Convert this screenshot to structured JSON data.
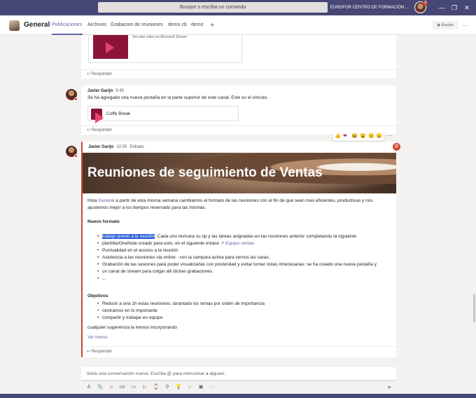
{
  "titlebar": {
    "search_placeholder": "Busque o escriba un comando",
    "org": "EUROFOR CENTRO DE FORMACIÓN ...",
    "badge": "3",
    "win": {
      "minimize": "—",
      "restore": "❐",
      "close": "✕"
    }
  },
  "header": {
    "channel": "General",
    "tabs": [
      "Publicaciones",
      "Archivos",
      "Grabacion de reuniones",
      "demo cb",
      "demo"
    ],
    "add": "+",
    "team_btn": "◉ Equipo",
    "more": "···"
  },
  "messages": {
    "top": {
      "caption": "Ver este vídeo en Microsoft Stream",
      "reply": "↩ Responder"
    },
    "m1": {
      "author": "Javier Garijo",
      "time": "9:45",
      "text": "Se ha agregado una nueva pestaña en la parte superior de este canal. Este es el vínculo.",
      "attachment": "Coffe Break",
      "reply": "↩ Responder"
    },
    "m2": {
      "author": "Javier Garijo",
      "time": "10:05",
      "edited": "Editado",
      "hero_title": "Reuniones de seguimiento de Ventas",
      "intro_a": "Hola ",
      "intro_link": "General",
      "intro_b": " a partir de esta misma semana cambiamos el formato de las reuniones con el fin de que sean mas eficientes, productivas y nos",
      "intro_c": "ajustemos mejor a los tiempos reservado para las mismas.",
      "section1": "Nuevo formato",
      "b1_hl": "trabajo previo a la reunión",
      "b1_a": ": Cada uno revisara su op y las tareas asignadas en las reuniones anterior completando la siguiente",
      "b1_b": "plantilla/OneNote creado para esto, en el siguiente enlace",
      "b1_link": "↗ Equipo ventas",
      "b2": "Puntualidad en el acceso a la reunión",
      "b3": "Asistencia a las reuniones via online - con la campara activa para vernos las caras.",
      "b4a": "Grabación de las sesiones para poder visualizarlas con posteridad y evitar tomar notas innecesarias: se ha creado una nueva pestaña y",
      "b4b": "un canal de stream para colgar alli dichas grabaciones.",
      "b5": "...",
      "section2": "Objetivos",
      "o1": "Reducir a una 1h estas reuniones, tarantado los temas por orden de importancia",
      "o2": "centramos en lo importante",
      "o3": "compartir y trabajar en equipo",
      "closing": "cualquier sugerencia la iremos incorporando",
      "see_less": "Ver menos",
      "reply": "↩ Responder"
    }
  },
  "reactions": [
    "👍",
    "❤",
    "😆",
    "😮",
    "😟",
    "😠"
  ],
  "react_more": "···",
  "mention_badge": "@",
  "compose": {
    "placeholder": "Inicie una conversación nueva. Escriba @ para mencionar a alguien.",
    "tools": [
      "A",
      "📎",
      "☺",
      "GIF",
      "▭",
      "▷",
      "⌚",
      "⚲",
      "💡",
      "☼",
      "▣",
      "···"
    ],
    "send": "➤"
  }
}
